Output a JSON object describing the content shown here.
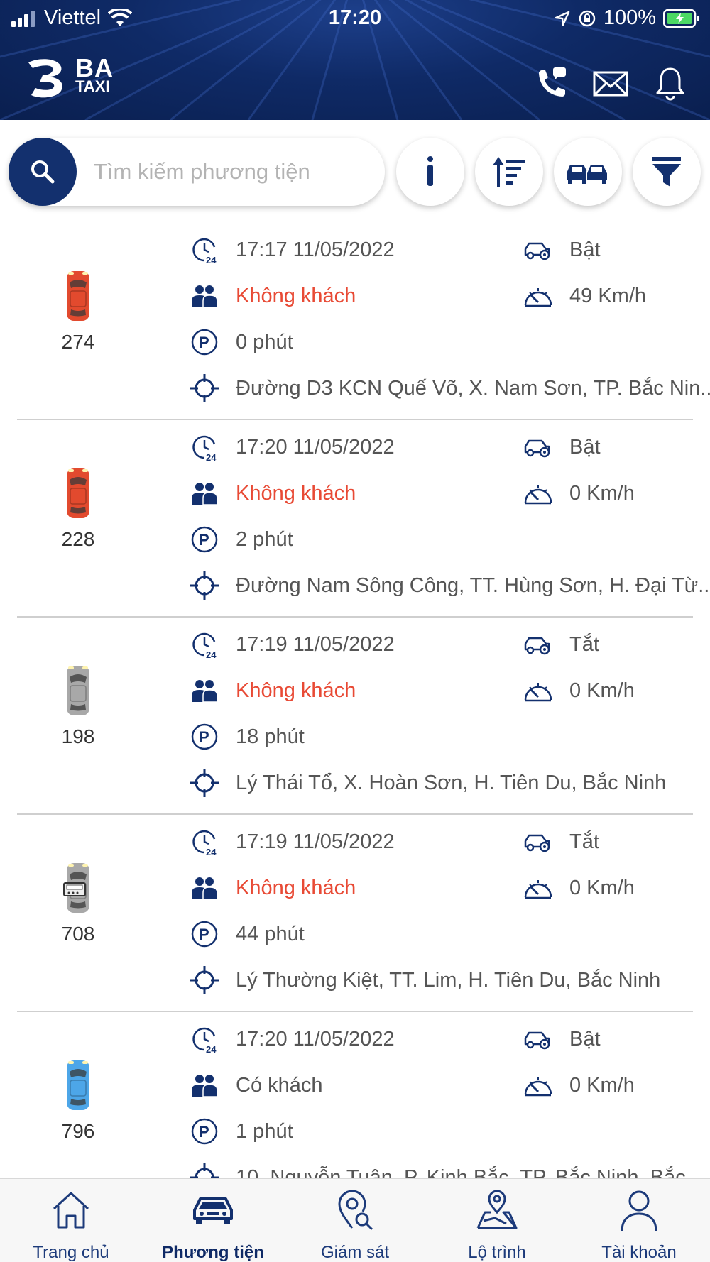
{
  "status_bar": {
    "carrier": "Viettel",
    "time": "17:20",
    "battery": "100%"
  },
  "header": {
    "logo_line1": "BA",
    "logo_line2": "TAXI",
    "icons": [
      "phone-icon",
      "mail-icon",
      "bell-icon"
    ]
  },
  "search": {
    "placeholder": "Tìm kiếm phương tiện"
  },
  "toolbar_buttons": [
    "info-icon",
    "sort-icon",
    "cars-icon",
    "filter-icon"
  ],
  "vehicles": [
    {
      "number": "274",
      "car_color": "red",
      "time": "17:17 11/05/2022",
      "engine": "Bật",
      "passenger": "Không khách",
      "passenger_flag": "empty",
      "speed": "49 Km/h",
      "parked": "0 phút",
      "address": "Đường D3 KCN Quế Võ, X. Nam Sơn, TP. Bắc Nin..."
    },
    {
      "number": "228",
      "car_color": "red",
      "time": "17:20 11/05/2022",
      "engine": "Bật",
      "passenger": "Không khách",
      "passenger_flag": "empty",
      "speed": "0 Km/h",
      "parked": "2 phút",
      "address": "Đường Nam Sông Công, TT. Hùng Sơn, H. Đại Từ..."
    },
    {
      "number": "198",
      "car_color": "gray",
      "time": "17:19 11/05/2022",
      "engine": "Tắt",
      "passenger": "Không khách",
      "passenger_flag": "empty",
      "speed": "0 Km/h",
      "parked": "18 phút",
      "address": "Lý Thái Tổ, X. Hoàn Sơn, H. Tiên Du, Bắc Ninh"
    },
    {
      "number": "708",
      "car_color": "gray-meter",
      "time": "17:19 11/05/2022",
      "engine": "Tắt",
      "passenger": "Không khách",
      "passenger_flag": "empty",
      "speed": "0 Km/h",
      "parked": "44 phút",
      "address": "Lý Thường Kiệt, TT. Lim, H. Tiên Du, Bắc Ninh"
    },
    {
      "number": "796",
      "car_color": "blue",
      "time": "17:20 11/05/2022",
      "engine": "Bật",
      "passenger": "Có khách",
      "passenger_flag": "occupied",
      "speed": "0 Km/h",
      "parked": "1 phút",
      "address": "10, Nguyễn Tuân, P. Kinh Bắc, TP. Bắc Ninh, Bắc..."
    }
  ],
  "bottom_nav": [
    {
      "label": "Trang chủ",
      "icon": "home-icon"
    },
    {
      "label": "Phương tiện",
      "icon": "car-icon",
      "active": true
    },
    {
      "label": "Giám sát",
      "icon": "monitor-pin-icon"
    },
    {
      "label": "Lộ trình",
      "icon": "route-map-icon"
    },
    {
      "label": "Tài khoản",
      "icon": "user-icon"
    }
  ],
  "colors": {
    "navy": "#13306e",
    "red_text": "#e84a35",
    "car_red": "#e24a2e",
    "car_gray": "#a8a8a8",
    "car_blue": "#4da6e8"
  }
}
